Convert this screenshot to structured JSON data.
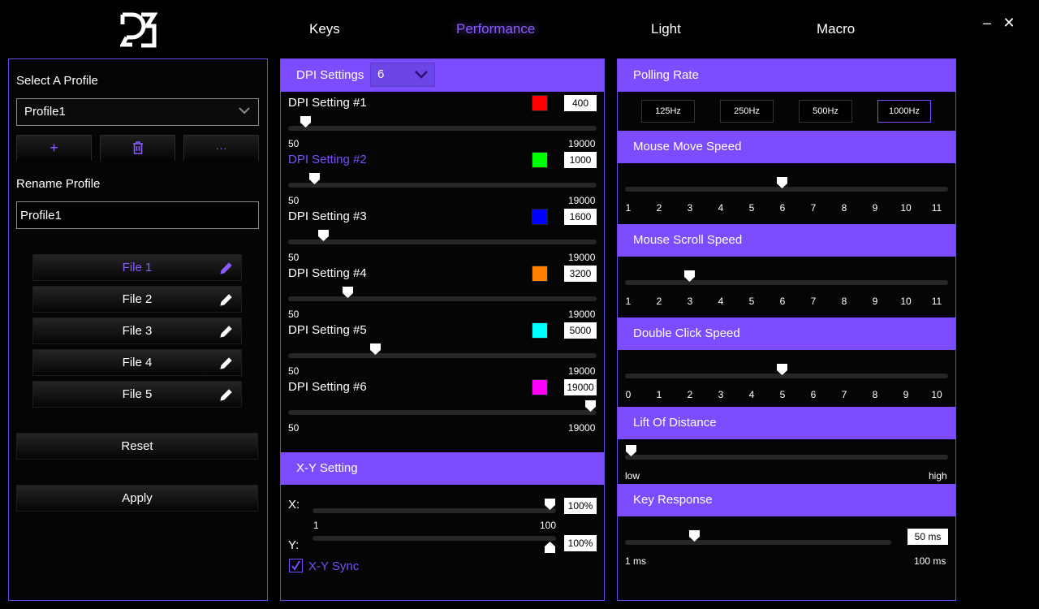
{
  "nav": {
    "tabs": [
      "Keys",
      "Performance",
      "Light",
      "Macro"
    ],
    "active": "Performance"
  },
  "window": {
    "minimize": "–",
    "close": "✕"
  },
  "profile": {
    "select_label": "Select A Profile",
    "selected": "Profile1",
    "add_icon": "+",
    "more_icon": "···",
    "rename_label": "Rename Profile",
    "rename_value": "Profile1",
    "files": [
      "File 1",
      "File 2",
      "File 3",
      "File 4",
      "File 5"
    ],
    "active_file": "File 1",
    "reset": "Reset",
    "apply": "Apply"
  },
  "dpi": {
    "title": "DPI Settings",
    "count": "6",
    "min_label": "50",
    "max_label": "19000",
    "settings": [
      {
        "label": "DPI Setting #1",
        "color": "#ff0000",
        "value": "400",
        "level": 0.02
      },
      {
        "label": "DPI Setting #2",
        "color": "#00ff00",
        "value": "1000",
        "level": 0.05
      },
      {
        "label": "DPI Setting #3",
        "color": "#0000ff",
        "value": "1600",
        "level": 0.082
      },
      {
        "label": "DPI Setting #4",
        "color": "#ff8000",
        "value": "3200",
        "level": 0.166
      },
      {
        "label": "DPI Setting #5",
        "color": "#00ffff",
        "value": "5000",
        "level": 0.26
      },
      {
        "label": "DPI Setting #6",
        "color": "#ff00ff",
        "value": "19000",
        "level": 1.0
      }
    ],
    "active_index": 1
  },
  "xy": {
    "title": "X-Y Setting",
    "x_label": "X:",
    "y_label": "Y:",
    "x_value": "100%",
    "y_value": "100%",
    "min_label": "1",
    "max_label": "100",
    "sync_label": "X-Y Sync",
    "sync_checked": true
  },
  "polling": {
    "title": "Polling Rate",
    "options": [
      "125Hz",
      "250Hz",
      "500Hz",
      "1000Hz"
    ],
    "active": "1000Hz"
  },
  "move_speed": {
    "title": "Mouse Move Speed",
    "ticks": [
      "1",
      "2",
      "3",
      "4",
      "5",
      "6",
      "7",
      "8",
      "9",
      "10",
      "11"
    ],
    "value": 6
  },
  "scroll_speed": {
    "title": "Mouse Scroll Speed",
    "ticks": [
      "1",
      "2",
      "3",
      "4",
      "5",
      "6",
      "7",
      "8",
      "9",
      "10",
      "11"
    ],
    "value": 3
  },
  "double_click": {
    "title": "Double Click Speed",
    "ticks": [
      "0",
      "1",
      "2",
      "3",
      "4",
      "5",
      "6",
      "7",
      "8",
      "9",
      "10"
    ],
    "value": 5
  },
  "lift": {
    "title": "Lift Of Distance",
    "low": "low",
    "high": "high",
    "level": 0.0
  },
  "key_response": {
    "title": "Key Response",
    "value": "50 ms",
    "min_label": "1 ms",
    "max_label": "100 ms",
    "level": 0.25
  }
}
